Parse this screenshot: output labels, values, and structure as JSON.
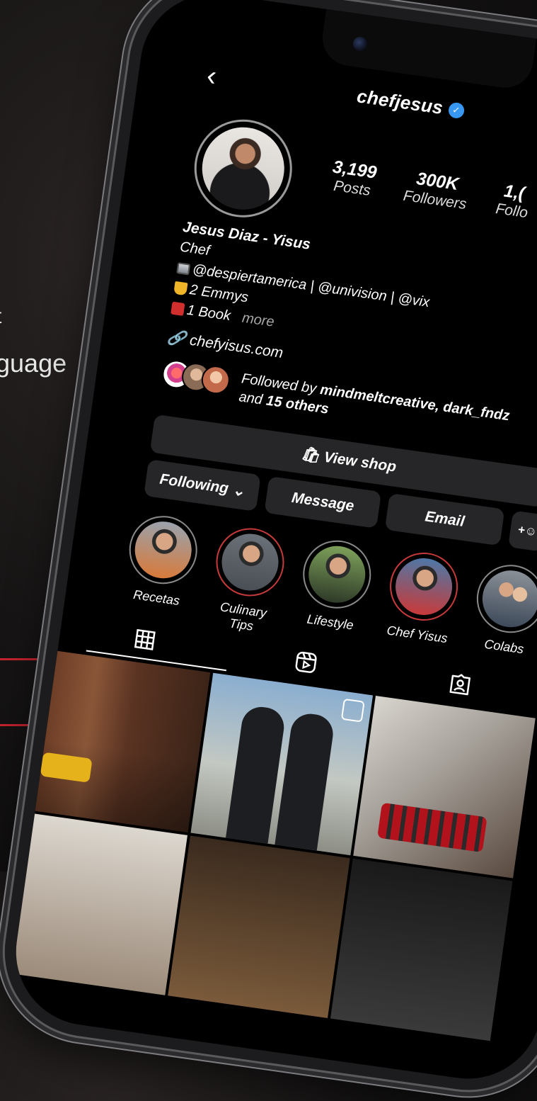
{
  "slide": {
    "text_fragment_1": "t",
    "text_fragment_2": "guage",
    "accent_color": "#c4232d"
  },
  "profile": {
    "username": "chefjesus",
    "verified": true,
    "stats": [
      {
        "value": "3,199",
        "label": "Posts"
      },
      {
        "value": "300K",
        "label": "Followers"
      },
      {
        "value": "1,(",
        "label": "Follo"
      }
    ],
    "display_name": "Jesus Diaz - Yisus",
    "category": "Chef",
    "bio_lines": [
      {
        "icon": "tv-icon",
        "text": "@despiertamerica | @univision | @vix"
      },
      {
        "icon": "trophy-icon",
        "text": "2 Emmys"
      },
      {
        "icon": "book-icon",
        "text": "1 Book"
      }
    ],
    "more_label": "more",
    "website": "chefyisus.com",
    "followed_by_prefix": "Followed by ",
    "followed_by_names": "mindmeltcreative, dark_fndz",
    "followed_by_and": "and ",
    "followed_by_others": "15 others"
  },
  "buttons": {
    "view_shop": "View shop",
    "following": "Following",
    "message": "Message",
    "email": "Email",
    "add_user": "+☺"
  },
  "highlights": [
    {
      "label": "Recetas"
    },
    {
      "label": "Culinary Tips"
    },
    {
      "label": "Lifestyle"
    },
    {
      "label": "Chef Yisus"
    },
    {
      "label": "Colabs"
    }
  ],
  "tabs": [
    {
      "icon": "grid-icon",
      "active": true
    },
    {
      "icon": "reels-icon",
      "active": false
    },
    {
      "icon": "tagged-icon",
      "active": false
    }
  ]
}
